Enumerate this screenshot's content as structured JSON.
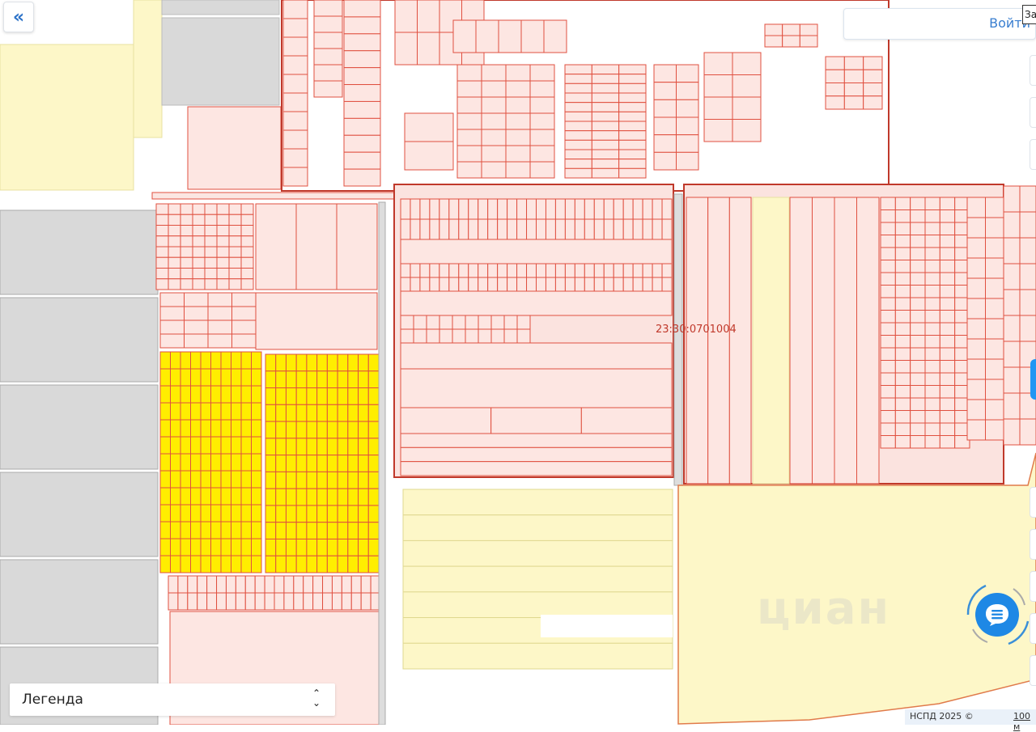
{
  "nav": {
    "back_label": "«"
  },
  "header": {
    "login_label": "Войти",
    "tooltip": "За"
  },
  "map": {
    "cadastral_label": "23:30:0701004",
    "watermark": "циан",
    "colors": {
      "parcel_fill": "#fde6e2",
      "parcel_stroke": "#e05040",
      "selected_fill": "#ffee00",
      "zone_fill": "#fdf7c8",
      "block_fill": "#d9d9d9",
      "quarter_stroke": "#c0392b"
    }
  },
  "legend": {
    "label": "Легенда",
    "chevron": "⌃⌄"
  },
  "footer": {
    "attribution": "НСПД 2025 ©",
    "scale": "100 м"
  },
  "chat": {
    "icon": "chat-icon",
    "color": "#1e88e5"
  }
}
